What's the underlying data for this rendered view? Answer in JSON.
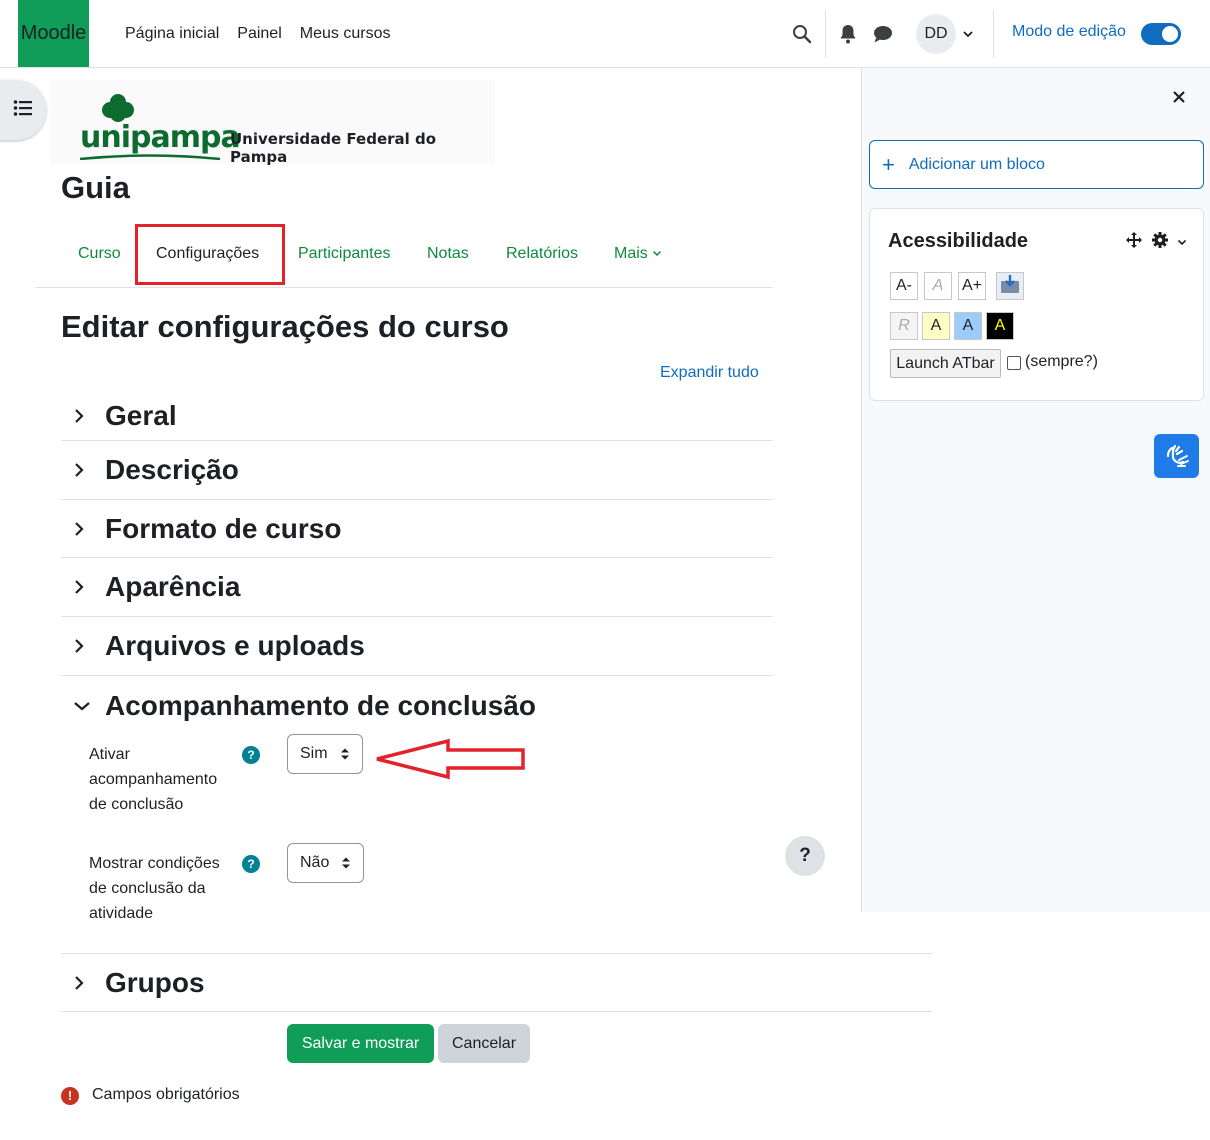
{
  "navbar": {
    "brand": "Moodle",
    "links": [
      "Página inicial",
      "Painel",
      "Meus cursos"
    ],
    "user_initials": "DD",
    "edit_mode_label": "Modo de edição"
  },
  "logo": {
    "word": "unipampa",
    "subtitle": "Universidade Federal do Pampa"
  },
  "course": {
    "title": "Guia"
  },
  "secondary_nav": {
    "tabs": [
      "Curso",
      "Configurações",
      "Participantes",
      "Notas",
      "Relatórios",
      "Mais"
    ],
    "active": "Configurações"
  },
  "page": {
    "heading": "Editar configurações do curso",
    "expand_all": "Expandir tudo"
  },
  "sections": {
    "geral": "Geral",
    "descricao": "Descrição",
    "formato": "Formato de curso",
    "aparencia": "Aparência",
    "arquivos": "Arquivos e uploads",
    "acompanhamento": "Acompanhamento de conclusão",
    "grupos": "Grupos"
  },
  "completion": {
    "enable_label": "Ativar acompanhamento de conclusão",
    "enable_value": "Sim",
    "show_conditions_label": "Mostrar condições de conclusão da atividade",
    "show_conditions_value": "Não"
  },
  "buttons": {
    "save": "Salvar e mostrar",
    "cancel": "Cancelar"
  },
  "required": {
    "icon": "!",
    "text": "Campos obrigatórios"
  },
  "help": {
    "mark": "?"
  },
  "drawer": {
    "add_block": "Adicionar um bloco",
    "block_title": "Acessibilidade",
    "atbar": {
      "text_smaller": "A-",
      "text_reset": "A",
      "text_bigger": "A+",
      "color_reset": "R",
      "color_yellow": "A",
      "color_blue": "A",
      "color_black": "A",
      "launch": "Launch ATbar",
      "always_label": "(sempre?)"
    }
  },
  "colors": {
    "primary": "#0f6cbf",
    "brand_green": "#0f9d58",
    "tab_link": "#0f8a3c",
    "annotation_red": "#e3232b",
    "help_teal": "#008196",
    "required_red": "#ca3120"
  }
}
